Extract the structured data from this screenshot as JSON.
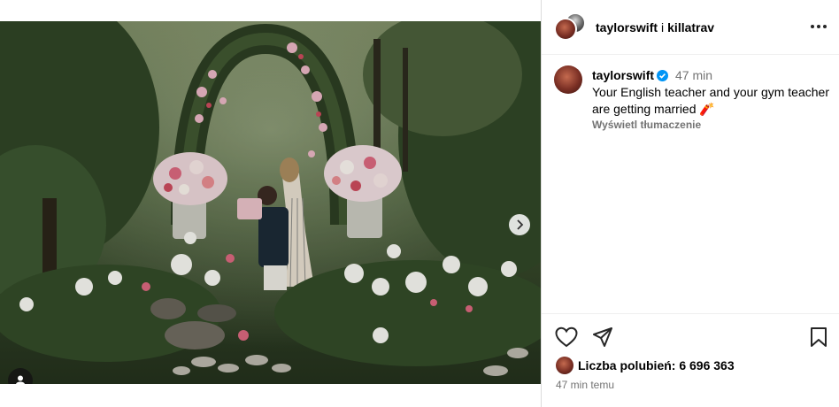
{
  "post": {
    "header_user": "taylorswift",
    "header_separator": "i",
    "header_collab": "killatrav"
  },
  "caption": {
    "username": "taylorswift",
    "time": "47 min",
    "text": "Your English teacher and your gym teacher are getting married",
    "emoji": "🧨",
    "translate": "Wyświetl tłumaczenie"
  },
  "actions": {
    "likes_label": "Liczba polubień: 6 696 363",
    "time_ago": "47 min temu"
  },
  "icons": {
    "more": "more-options-icon",
    "verified": "verified-badge-icon",
    "like": "heart-icon",
    "share": "paper-plane-icon",
    "save": "bookmark-icon",
    "next": "chevron-right-icon",
    "tags": "person-tag-icon"
  },
  "colors": {
    "verified": "#0095f6",
    "secondary_text": "#737373"
  }
}
